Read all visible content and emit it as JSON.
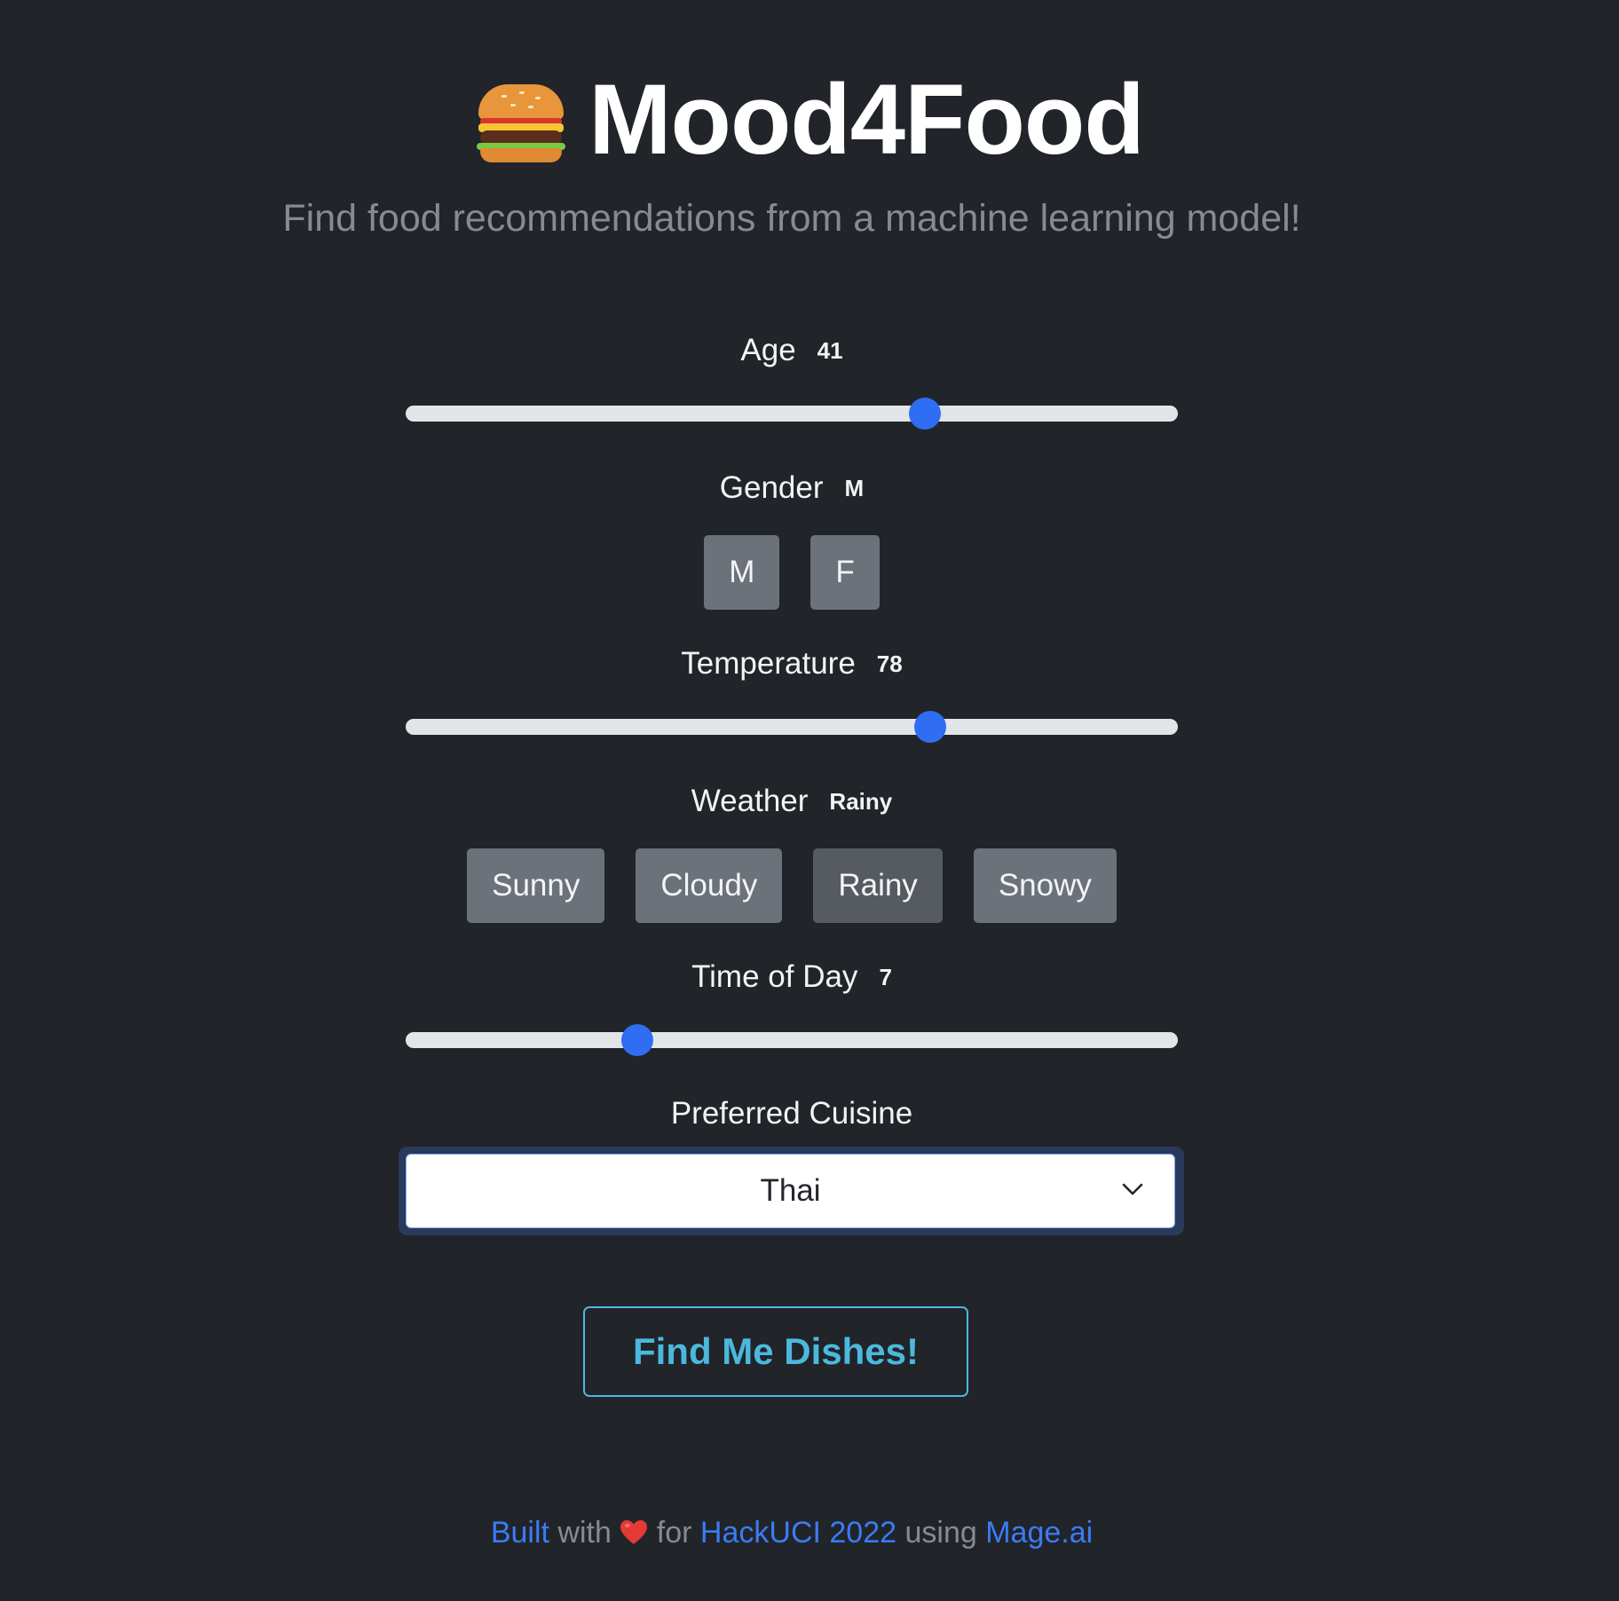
{
  "app": {
    "title": "Mood4Food",
    "subtitle": "Find food recommendations from a machine learning model!"
  },
  "form": {
    "age": {
      "label": "Age",
      "value": "41",
      "fraction": 0.672
    },
    "gender": {
      "label": "Gender",
      "value": "M",
      "options": [
        "M",
        "F"
      ]
    },
    "temperature": {
      "label": "Temperature",
      "value": "78",
      "fraction": 0.679
    },
    "weather": {
      "label": "Weather",
      "value": "Rainy",
      "options": [
        "Sunny",
        "Cloudy",
        "Rainy",
        "Snowy"
      ]
    },
    "time_of_day": {
      "label": "Time of Day",
      "value": "7",
      "fraction": 0.3
    },
    "cuisine": {
      "label": "Preferred Cuisine",
      "value": "Thai"
    }
  },
  "cta": {
    "label": "Find Me Dishes!"
  },
  "footer": {
    "built": "Built",
    "with": "with",
    "for": "for",
    "event": "HackUCI 2022",
    "using": "using",
    "tool": "Mage.ai"
  },
  "colors": {
    "background": "#212429",
    "accent": "#2f6ef3",
    "cta": "#4cb8de",
    "link": "#3a7cf5"
  },
  "icons": {
    "logo": "burger-icon",
    "heart": "heart-icon",
    "select": "chevron-down-icon"
  }
}
